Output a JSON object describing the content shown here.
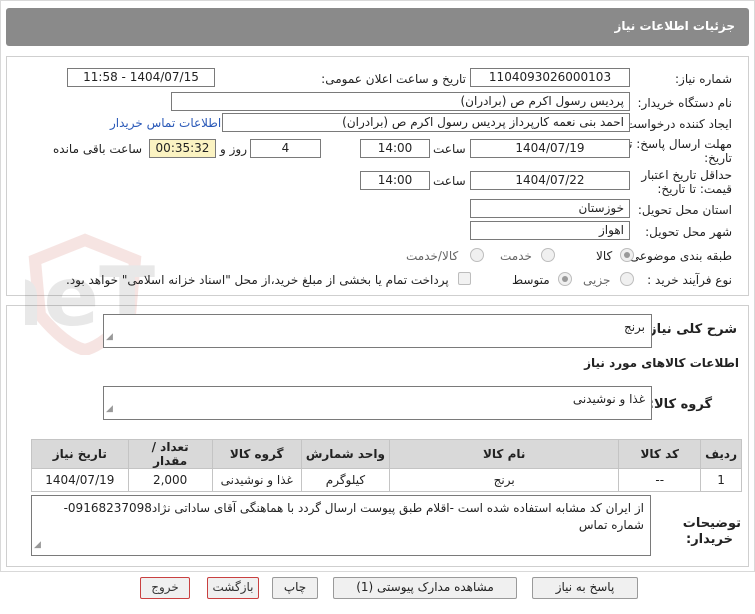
{
  "header": {
    "title": "جزئیات اطلاعات نیاز"
  },
  "fields": {
    "need_number_label": "شماره نیاز:",
    "need_number": "1104093026000103",
    "announce_label": "تاریخ و ساعت اعلان عمومی:",
    "announce_value": "1404/07/15 - 11:58",
    "buyer_org_label": "نام دستگاه خریدار:",
    "buyer_org": "پردیس رسول اکرم ص (برادران)",
    "creator_label": "ایجاد کننده درخواست:",
    "creator": "احمد بنی نعمه کارپرداز پردیس رسول اکرم ص (برادران)",
    "contact_link": "اطلاعات تماس خریدار",
    "deadline_label_1": "مهلت ارسال پاسخ: تا",
    "deadline_label_2": "تاریخ:",
    "deadline_date": "1404/07/19",
    "time_word": "ساعت",
    "deadline_time": "14:00",
    "days": "4",
    "days_word": "روز و",
    "remaining_time": "00:35:32",
    "remaining_word": "ساعت باقی مانده",
    "validity_label_1": "حداقل تاریخ اعتبار",
    "validity_label_2": "قیمت: تا تاریخ:",
    "validity_date": "1404/07/22",
    "validity_time": "14:00",
    "province_label": "استان محل تحویل:",
    "province": "خوزستان",
    "city_label": "شهر محل تحویل:",
    "city": "اهواز",
    "category_label": "طبقه بندی موضوعی:",
    "category_options": [
      "کالا",
      "خدمت",
      "کالا/خدمت"
    ],
    "process_label": "نوع فرآیند خرید :",
    "process_options": [
      "جزیی",
      "متوسط"
    ],
    "payment_note": "پرداخت تمام یا بخشی از مبلغ خرید،از محل \"اسناد خزانه اسلامی\" خواهد بود."
  },
  "summary": {
    "label": "شرح کلی نیاز:",
    "value": "برنج",
    "goods_info_title": "اطلاعات کالاهای مورد نیاز",
    "group_label": "گروه کالا:",
    "group_value": "غذا و نوشیدنی"
  },
  "table": {
    "headers": [
      "ردیف",
      "کد کالا",
      "نام کالا",
      "واحد شمارش",
      "تعداد / مقدار",
      "تاریخ نیاز"
    ],
    "rows": [
      [
        "1",
        "--",
        "برنج",
        "کیلوگرم",
        "2,000",
        "1404/07/19"
      ]
    ],
    "category_header": "گروه کالا",
    "row_category": "غذا و نوشیدنی"
  },
  "notes": {
    "label_1": "توضیحات",
    "label_2": "خریدار:",
    "text": "از ایران کد مشابه استفاده شده است -اقلام طبق پیوست ارسال گردد با هماهنگی آقای ساداتی نژاد09168237098-شماره تماس"
  },
  "buttons": {
    "respond": "پاسخ به نیاز",
    "docs": "مشاهده مدارک پیوستی (1)",
    "print": "چاپ",
    "back": "بازگشت",
    "exit": "خروج"
  },
  "watermark_text": "AriaTender.neT",
  "colors": {
    "titlebar": "#8a8a8a",
    "countdown_bg": "#fbf3c2",
    "link": "#2a59b8",
    "danger_border": "#c94040"
  }
}
